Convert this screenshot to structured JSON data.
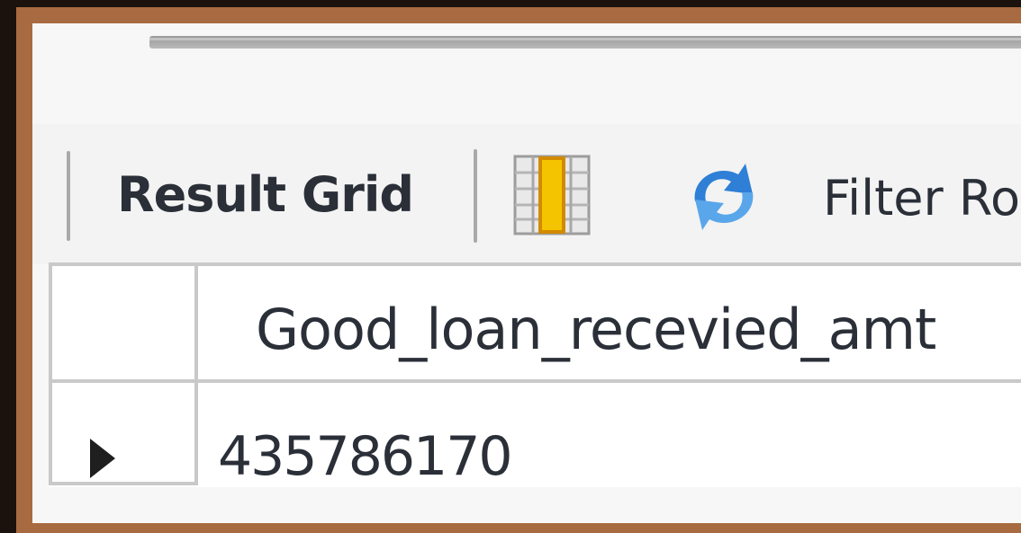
{
  "toolbar": {
    "result_grid_label": "Result Grid",
    "filter_label": "Filter Ro"
  },
  "icons": {
    "grid_icon": "grid-columns-icon",
    "refresh_icon": "refresh-icon"
  },
  "colors": {
    "frame": "#a86a41",
    "background": "#1b120d",
    "grid_icon_accent": "#f5c400",
    "refresh_icon": "#2f7fd6"
  },
  "result_grid": {
    "columns": [
      "Good_loan_recevied_amt"
    ],
    "rows": [
      [
        "435786170"
      ]
    ]
  }
}
